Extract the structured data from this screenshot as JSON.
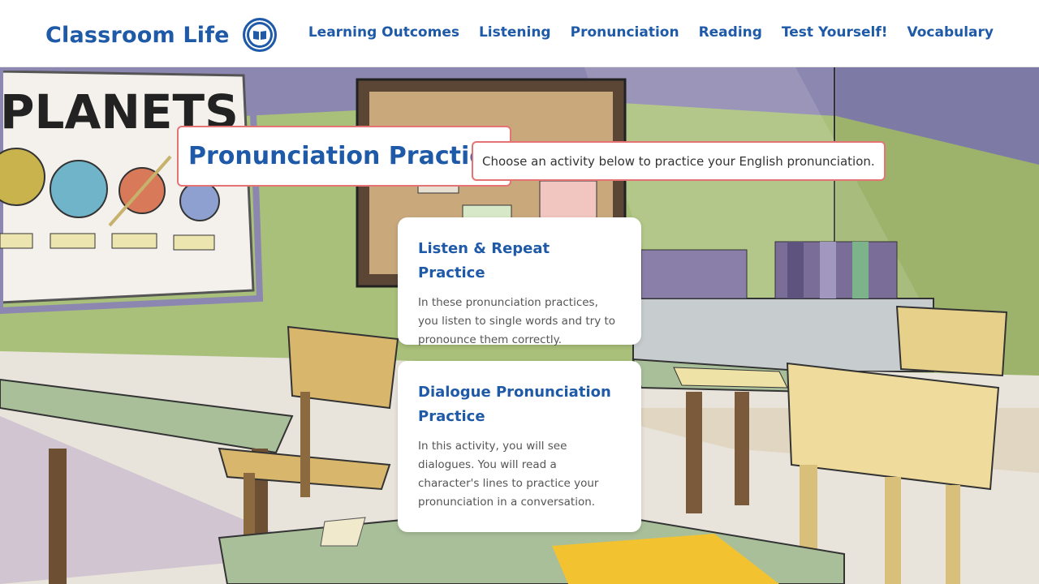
{
  "header": {
    "brand_title": "Classroom Life",
    "nav": [
      {
        "label": "Learning Outcomes"
      },
      {
        "label": "Listening"
      },
      {
        "label": "Pronunciation"
      },
      {
        "label": "Reading"
      },
      {
        "label": "Test Yourself!"
      },
      {
        "label": "Vocabulary"
      }
    ]
  },
  "scene": {
    "poster_text": "PLANETS"
  },
  "main": {
    "title": "Pronunciation Practice",
    "subtitle": "Choose an activity below to practice your English pronunciation.",
    "cards": [
      {
        "title": "Listen & Repeat Practice",
        "description": "In these pronunciation practices, you listen to single words and try to pronounce them correctly."
      },
      {
        "title": "Dialogue Pronunciation Practice",
        "description": "In this activity, you will see dialogues. You will read a character's lines to practice your pronunciation in a conversation."
      }
    ]
  },
  "colors": {
    "brand_blue": "#1f5aa8",
    "accent_border": "#e57373",
    "wall_green": "#a9c07a",
    "wall_purple": "#8c87b0"
  }
}
